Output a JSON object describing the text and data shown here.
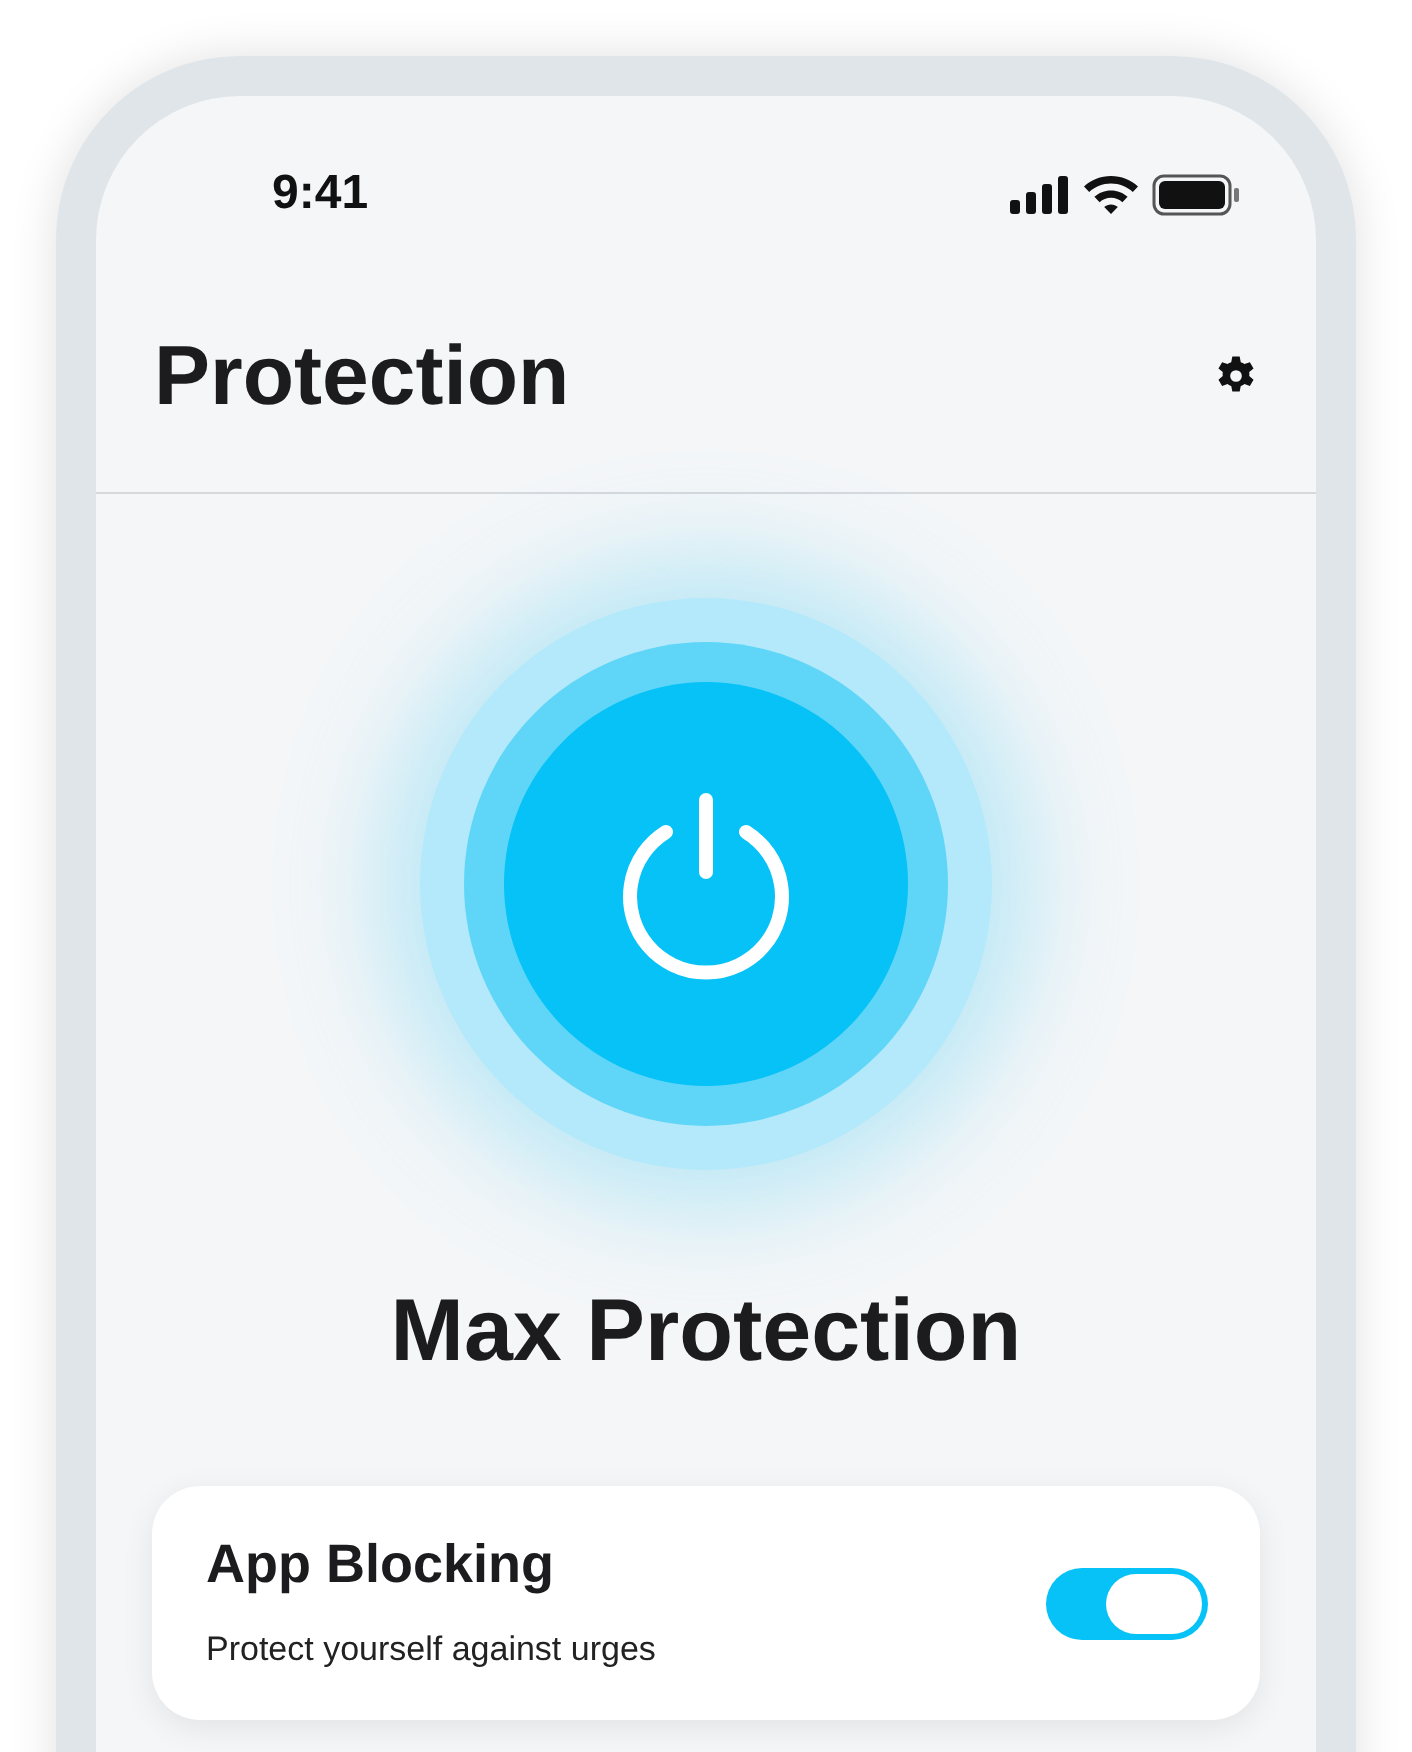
{
  "status_bar": {
    "time": "9:41"
  },
  "header": {
    "title": "Protection"
  },
  "power": {
    "on": true,
    "label": "Max Protection"
  },
  "settings": [
    {
      "title": "App Blocking",
      "description": "Protect yourself against urges",
      "on": true
    }
  ]
}
